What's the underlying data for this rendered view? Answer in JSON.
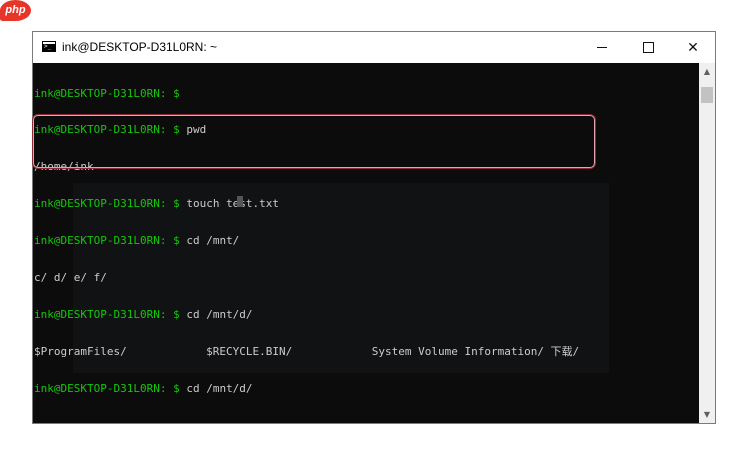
{
  "site": {
    "logo_text": "php"
  },
  "window": {
    "title": "ink@DESKTOP-D31L0RN: ~",
    "controls": {
      "minimize": "—",
      "maximize": "☐",
      "close": "✕"
    }
  },
  "console": {
    "lines": [
      {
        "prompt": "ink@DESKTOP-D31L0RN: $ ",
        "text": ""
      },
      {
        "prompt": "ink@DESKTOP-D31L0RN: $ ",
        "text": "pwd"
      },
      {
        "prompt": "",
        "text": "/home/ink"
      },
      {
        "prompt": "ink@DESKTOP-D31L0RN: $ ",
        "text": "touch test.txt"
      },
      {
        "prompt": "ink@DESKTOP-D31L0RN: $ ",
        "text": "cd /mnt/"
      },
      {
        "prompt": "",
        "text": "c/ d/ e/ f/"
      },
      {
        "prompt": "ink@DESKTOP-D31L0RN: $ ",
        "text": "cd /mnt/d/"
      },
      {
        "prompt": "",
        "text": "$ProgramFiles/            $RECYCLE.BIN/            System Volume Information/ 下载/"
      },
      {
        "prompt": "ink@DESKTOP-D31L0RN: $ ",
        "text": "cd /mnt/d/"
      }
    ]
  },
  "colors": {
    "prompt": "#16c60c",
    "text": "#cccccc",
    "background": "#0c0c0c",
    "highlight_border": "#e8a3ab"
  },
  "icons": {
    "app": "terminal-icon",
    "scroll_up": "arrow-up-icon",
    "scroll_down": "arrow-down-icon"
  },
  "scrollbar": {
    "up": "▲",
    "down": "▼"
  }
}
